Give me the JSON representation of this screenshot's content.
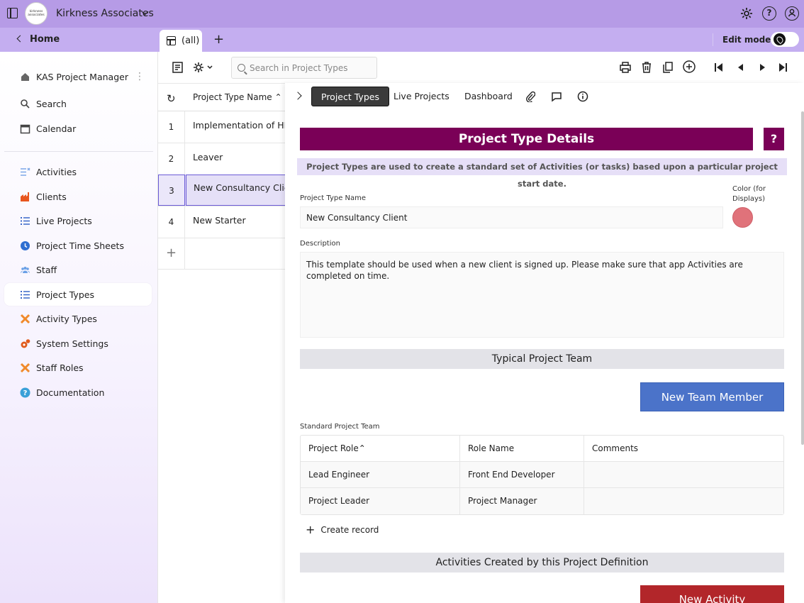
{
  "app": {
    "title": "Kirkness Associates",
    "logo_text": "kirkness associates"
  },
  "secondbar": {
    "home_label": "Home",
    "tab_label": "(all)",
    "edit_mode_label": "Edit mode"
  },
  "sidebar": {
    "header": "KAS Project Manager",
    "top_items": [
      {
        "label": "Search",
        "icon": "search-icon"
      },
      {
        "label": "Calendar",
        "icon": "calendar-icon"
      }
    ],
    "items": [
      {
        "label": "Activities",
        "icon": "activities-icon",
        "color": "#7da8e8"
      },
      {
        "label": "Clients",
        "icon": "factory-icon",
        "color": "#e8561e"
      },
      {
        "label": "Live Projects",
        "icon": "list-icon",
        "color": "#3a68c9"
      },
      {
        "label": "Project Time Sheets",
        "icon": "clock-icon",
        "color": "#2f6fd1"
      },
      {
        "label": "Staff",
        "icon": "people-icon",
        "color": "#6aa0e6"
      },
      {
        "label": "Project Types",
        "icon": "list-icon",
        "color": "#3a68c9"
      },
      {
        "label": "Activity Types",
        "icon": "tools-icon",
        "color": "#f08a2a"
      },
      {
        "label": "System Settings",
        "icon": "gears-icon",
        "color": "#e05a1c"
      },
      {
        "label": "Staff Roles",
        "icon": "tools-icon",
        "color": "#f08a2a"
      },
      {
        "label": "Documentation",
        "icon": "help-icon",
        "color": "#3aa0d8"
      }
    ]
  },
  "list": {
    "search_placeholder": "Search in Project Types",
    "column_header": "Project Type Name",
    "rows": [
      {
        "num": "1",
        "name": "Implementation of HR Systems"
      },
      {
        "num": "2",
        "name": "Leaver"
      },
      {
        "num": "3",
        "name": "New Consultancy Client"
      },
      {
        "num": "4",
        "name": "New Starter"
      }
    ],
    "selected_index": 2
  },
  "detail": {
    "tabs": [
      "Project Types",
      "Live Projects",
      "Dashboard"
    ],
    "active_tab": "Project Types",
    "header": "Project Type Details",
    "help_label": "?",
    "subheader": "Project Types are used to create a standard set of Activities (or tasks) based upon a particular project start date.",
    "name_label": "Project Type Name",
    "name_value": "New Consultancy Client",
    "color_label": "Color (for Displays)",
    "color_value": "#e0727a",
    "description_label": "Description",
    "description_value": "This template should be used when a new client is signed up. Please make sure that app Activities are completed on time.",
    "team_section": "Typical Project Team",
    "new_team_member_label": "New Team Member",
    "team_table_label": "Standard Project Team",
    "team_columns": [
      "Project Role",
      "Role Name",
      "Comments"
    ],
    "team_rows": [
      [
        "Lead Engineer",
        "Front End Developer",
        ""
      ],
      [
        "Project Leader",
        "Project Manager",
        ""
      ]
    ],
    "create_record_label": "Create record",
    "activities_section": "Activities Created by this Project Definition",
    "new_activity_label": "New Activity"
  }
}
